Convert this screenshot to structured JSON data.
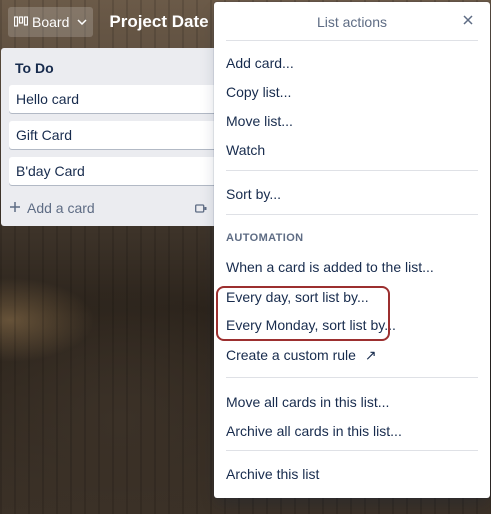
{
  "header": {
    "board_switch_label": "Board",
    "board_title": "Project Date"
  },
  "list": {
    "title": "To Do",
    "cards": [
      "Hello card",
      "Gift Card",
      "B'day Card"
    ],
    "add_card_label": "Add a card"
  },
  "popover": {
    "title": "List actions",
    "close_glyph": "×",
    "items_group1": [
      "Add card...",
      "Copy list...",
      "Move list...",
      "Watch"
    ],
    "sort_by": "Sort by...",
    "automation_label": "AUTOMATION",
    "automation_items": [
      "When a card is added to the list...",
      "Every day, sort list by...",
      "Every Monday, sort list by..."
    ],
    "custom_rule": "Create a custom rule",
    "custom_rule_arrow": "↗",
    "bulk_items": [
      "Move all cards in this list...",
      "Archive all cards in this list..."
    ],
    "archive_list": "Archive this list"
  },
  "colors": {
    "highlight_border": "#9c2f2f",
    "list_bg": "#ebecf0",
    "text_dark": "#172b4d",
    "text_muted": "#5e6c84"
  }
}
